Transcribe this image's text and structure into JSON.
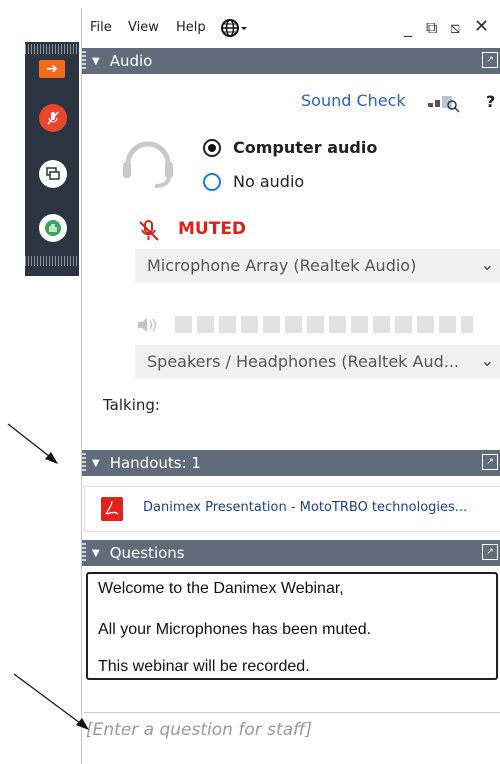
{
  "menubar": {
    "file": "File",
    "view": "View",
    "help": "Help",
    "globe_icon": "globe-icon"
  },
  "window_controls": {
    "minimize": "_",
    "restore": "⧉",
    "popout": "⧅",
    "close": "✕"
  },
  "audio": {
    "header": "Audio",
    "sound_check": "Sound Check",
    "help": "?",
    "computer_audio": "Computer audio",
    "no_audio": "No audio",
    "muted": "MUTED",
    "microphone": "Microphone Array (Realtek Audio)",
    "speakers": "Speakers / Headphones (Realtek Aud...",
    "talking": "Talking:"
  },
  "handouts": {
    "header": "Handouts: 1",
    "file": "Danimex Presentation - MotoTRBO technologies..."
  },
  "questions": {
    "header": "Questions",
    "messages": [
      "Welcome to the Danimex Webinar,",
      "All your Microphones has been muted.",
      "This webinar will be recorded."
    ],
    "placeholder": "[Enter a question for staff]"
  },
  "colors": {
    "header_bg": "#606c79",
    "muted_red": "#d9231a",
    "link_blue": "#2a63b8",
    "toolbar_bg": "#2b3440"
  }
}
